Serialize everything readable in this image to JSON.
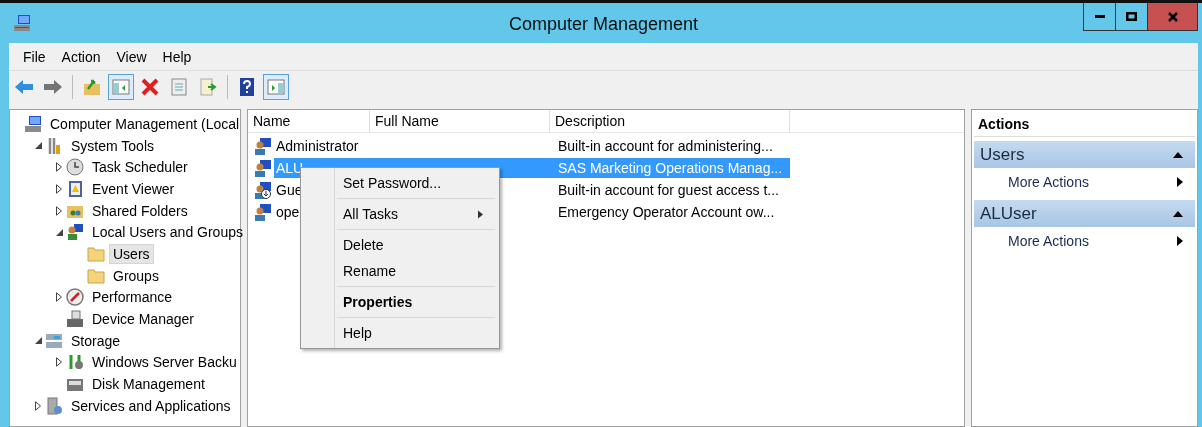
{
  "window": {
    "title": "Computer Management"
  },
  "menu": [
    "File",
    "Action",
    "View",
    "Help"
  ],
  "toolbar": [
    {
      "kind": "button",
      "disabled": false,
      "pressed": false
    },
    {
      "kind": "button",
      "disabled": true,
      "pressed": false
    },
    {
      "kind": "separator"
    },
    {
      "kind": "button",
      "disabled": false,
      "pressed": false
    },
    {
      "kind": "button",
      "disabled": false,
      "pressed": true
    },
    {
      "kind": "button",
      "disabled": false,
      "pressed": false
    },
    {
      "kind": "button",
      "disabled": false,
      "pressed": false
    },
    {
      "kind": "button",
      "disabled": false,
      "pressed": false
    },
    {
      "kind": "separator"
    },
    {
      "kind": "button",
      "disabled": false,
      "pressed": false
    },
    {
      "kind": "button",
      "disabled": false,
      "pressed": true
    }
  ],
  "tree": [
    {
      "label": "Computer Management (Local",
      "selected": false,
      "children": [
        {
          "label": "System Tools",
          "expanded": true,
          "selected": false,
          "children": [
            {
              "label": "Task Scheduler",
              "expanded": false,
              "selected": false
            },
            {
              "label": "Event Viewer",
              "expanded": false,
              "selected": false
            },
            {
              "label": "Shared Folders",
              "expanded": false,
              "selected": false
            },
            {
              "label": "Local Users and Groups",
              "expanded": true,
              "selected": false,
              "children": [
                {
                  "label": "Users",
                  "selected": true
                },
                {
                  "label": "Groups",
                  "selected": false
                }
              ]
            },
            {
              "label": "Performance",
              "expanded": false,
              "selected": false
            },
            {
              "label": "Device Manager",
              "selected": false
            }
          ]
        },
        {
          "label": "Storage",
          "expanded": true,
          "selected": false,
          "children": [
            {
              "label": "Windows Server Backu",
              "expanded": false,
              "selected": false
            },
            {
              "label": "Disk Management",
              "selected": false
            }
          ]
        },
        {
          "label": "Services and Applications",
          "expanded": false,
          "selected": false
        }
      ]
    }
  ],
  "list": {
    "columns": [
      "Name",
      "Full Name",
      "Description"
    ],
    "rows": [
      {
        "name": "Administrator",
        "description": "Built-in account for administering...",
        "selected": false
      },
      {
        "name": "ALU",
        "description": "SAS Marketing Operations Manag...",
        "selected": true
      },
      {
        "name": "Gue",
        "description": "Built-in account for guest access t...",
        "selected": false
      },
      {
        "name": "ope",
        "description": "Emergency Operator Account ow...",
        "selected": false
      }
    ]
  },
  "context_menu": [
    {
      "kind": "item",
      "label": "Set Password...",
      "submenu": false,
      "default": false
    },
    {
      "kind": "separator"
    },
    {
      "kind": "item",
      "label": "All Tasks",
      "submenu": true,
      "default": false
    },
    {
      "kind": "separator"
    },
    {
      "kind": "item",
      "label": "Delete",
      "submenu": false,
      "default": false
    },
    {
      "kind": "item",
      "label": "Rename",
      "submenu": false,
      "default": false
    },
    {
      "kind": "separator"
    },
    {
      "kind": "item",
      "label": "Properties",
      "submenu": false,
      "default": true
    },
    {
      "kind": "separator"
    },
    {
      "kind": "item",
      "label": "Help",
      "submenu": false,
      "default": false
    }
  ],
  "actions": {
    "title": "Actions",
    "sections": [
      {
        "title": "Users",
        "expanded": true,
        "items": [
          "More Actions"
        ]
      },
      {
        "title": "ALUser",
        "expanded": true,
        "items": [
          "More Actions"
        ]
      }
    ]
  }
}
